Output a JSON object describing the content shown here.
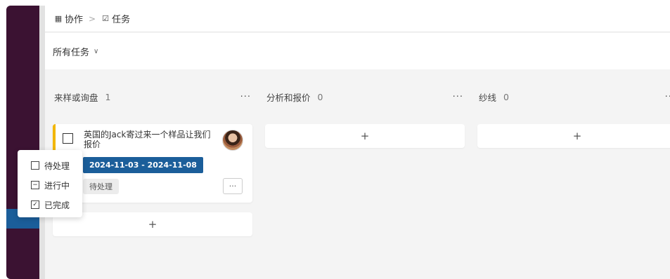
{
  "breadcrumb": {
    "app_icon": "grid-icon",
    "app_label": "协作",
    "separator": ">",
    "task_icon": "checkbox-icon",
    "task_label": "任务"
  },
  "view": {
    "label": "所有任务",
    "chevron": "chevron-down-icon"
  },
  "columns": [
    {
      "title": "来样或询盘",
      "count": "1",
      "more": "···",
      "add": "+"
    },
    {
      "title": "分析和报价",
      "count": "0",
      "more": "···",
      "add": "+"
    },
    {
      "title": "纱线",
      "count": "0",
      "more": "···",
      "add": "+"
    }
  ],
  "task": {
    "title": "英国的Jack寄过来一个样品让我们报价",
    "date_range": "2024-11-03 - 2024-11-08",
    "status": "待处理",
    "more": "···",
    "accent_color": "#f2b600"
  },
  "status_menu": {
    "options": [
      {
        "label": "待处理",
        "mark": ""
      },
      {
        "label": "进行中",
        "mark": "−"
      },
      {
        "label": "已完成",
        "mark": "✓"
      }
    ]
  },
  "colors": {
    "sidebar": "#3b1232",
    "accent_blue": "#1b5e9a",
    "background": "#f4f4f4"
  }
}
